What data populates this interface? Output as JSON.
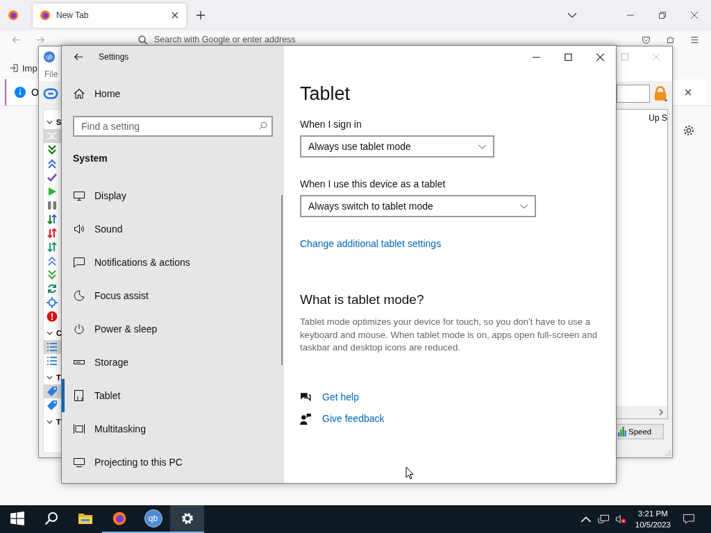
{
  "browser": {
    "tabs": [
      {
        "label": "New Tab",
        "selected": true
      }
    ],
    "address_placeholder": "Search with Google or enter address",
    "bookmark": "Imp",
    "notification": "O"
  },
  "qbittorrent": {
    "logo": "qb",
    "menu": "File",
    "column_header": "Up S",
    "status_button": "Speed",
    "sidebar": [
      {
        "header": "S",
        "items": [
          {
            "kind": "shuffle",
            "selected": true
          },
          {
            "kind": "down",
            "selected": false
          },
          {
            "kind": "up",
            "selected": false
          },
          {
            "kind": "check",
            "selected": false
          },
          {
            "kind": "play",
            "selected": false
          },
          {
            "kind": "pause",
            "selected": false
          },
          {
            "kind": "updown",
            "selected": false
          },
          {
            "kind": "updown-red",
            "selected": false
          },
          {
            "kind": "updown-teal",
            "selected": false
          },
          {
            "kind": "up-light",
            "selected": false
          },
          {
            "kind": "down-light",
            "selected": false
          },
          {
            "kind": "refresh",
            "selected": false
          },
          {
            "kind": "target",
            "selected": false
          },
          {
            "kind": "error",
            "selected": false
          }
        ]
      },
      {
        "header": "C",
        "items": [
          {
            "kind": "list",
            "selected": true
          },
          {
            "kind": "list",
            "selected": false
          }
        ]
      },
      {
        "header": "T",
        "items": [
          {
            "kind": "tag",
            "selected": true
          },
          {
            "kind": "tag",
            "selected": false
          }
        ]
      },
      {
        "header": "T"
      }
    ]
  },
  "settings": {
    "title": "Settings",
    "home": "Home",
    "search_placeholder": "Find a setting",
    "section": "System",
    "nav": [
      {
        "kind": "display",
        "label": "Display",
        "selected": false
      },
      {
        "kind": "sound",
        "label": "Sound",
        "selected": false
      },
      {
        "kind": "notifications",
        "label": "Notifications & actions",
        "selected": false
      },
      {
        "kind": "focus",
        "label": "Focus assist",
        "selected": false
      },
      {
        "kind": "power",
        "label": "Power & sleep",
        "selected": false
      },
      {
        "kind": "storage",
        "label": "Storage",
        "selected": false
      },
      {
        "kind": "tablet",
        "label": "Tablet",
        "selected": true
      },
      {
        "kind": "multitasking",
        "label": "Multitasking",
        "selected": false
      },
      {
        "kind": "projecting",
        "label": "Projecting to this PC",
        "selected": false
      }
    ],
    "page_title": "Tablet",
    "fields": [
      {
        "label": "When I sign in",
        "value": "Always use tablet mode"
      },
      {
        "label": "When I use this device as a tablet",
        "value": "Always switch to tablet mode"
      }
    ],
    "link": "Change additional tablet settings",
    "about_title": "What is tablet mode?",
    "about_text": "Tablet mode optimizes your device for touch, so you don't have to use a keyboard and mouse. When tablet mode is on, apps open full-screen and taskbar and desktop icons are reduced.",
    "help_links": [
      {
        "kind": "help",
        "label": "Get help"
      },
      {
        "kind": "feedback",
        "label": "Give feedback"
      }
    ]
  },
  "taskbar": {
    "apps": [
      {
        "kind": "start",
        "running": false,
        "selected": false
      },
      {
        "kind": "search",
        "running": false,
        "selected": false
      },
      {
        "kind": "explorer",
        "running": false,
        "selected": false
      },
      {
        "kind": "firefox",
        "running": true,
        "selected": false
      },
      {
        "kind": "qbittorrent",
        "running": true,
        "selected": false,
        "label": "qb"
      },
      {
        "kind": "settings",
        "running": true,
        "selected": true
      }
    ],
    "time": "3:21 PM",
    "date": "10/5/2023"
  }
}
